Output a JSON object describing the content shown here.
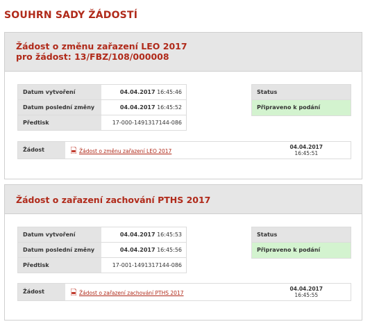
{
  "page": {
    "title": "SOUHRN SADY ŽÁDOSTÍ"
  },
  "labels": {
    "created": "Datum vytvoření",
    "last_change": "Datum poslední změny",
    "print": "Předtisk",
    "status": "Status",
    "request": "Žádost"
  },
  "cards": [
    {
      "title_line1": "Žádost o změnu zařazení LEO 2017",
      "title_line2": "pro žádost: 13/FBZ/108/000008",
      "created_date": "04.04.2017",
      "created_time": "16:45:46",
      "changed_date": "04.04.2017",
      "changed_time": "16:45:52",
      "print_id": "17-000-1491317144-086",
      "status": "Připraveno k podání",
      "doc_link": "Žádost o změnu zařazení LEO 2017",
      "doc_date": "04.04.2017",
      "doc_time": "16:45:51"
    },
    {
      "title_line1": "Žádost o zařazení zachování PTHS 2017",
      "created_date": "04.04.2017",
      "created_time": "16:45:53",
      "changed_date": "04.04.2017",
      "changed_time": "16:45:56",
      "print_id": "17-001-1491317144-086",
      "status": "Připraveno k podání",
      "doc_link": "Žádost o zařazení zachování PTHS 2017",
      "doc_date": "04.04.2017",
      "doc_time": "16:45:55"
    }
  ],
  "icons": {
    "pdf": "pdf-icon"
  },
  "colors": {
    "accent": "#b02a1a",
    "status_ok": "#d3f3cf",
    "header_bg": "#e6e6e6"
  }
}
